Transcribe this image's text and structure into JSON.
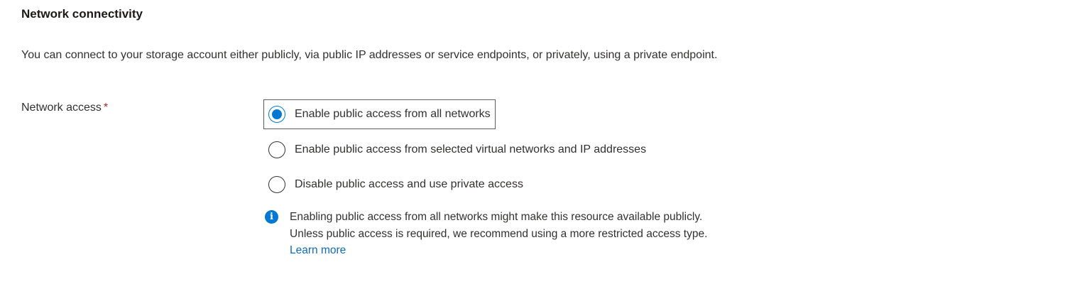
{
  "section": {
    "title": "Network connectivity",
    "description": "You can connect to your storage account either publicly, via public IP addresses or service endpoints, or privately, using a private endpoint."
  },
  "network_access": {
    "label": "Network access",
    "required_marker": "*",
    "selected_index": 0,
    "options": [
      {
        "label": "Enable public access from all networks",
        "checked": true
      },
      {
        "label": "Enable public access from selected virtual networks and IP addresses",
        "checked": false
      },
      {
        "label": "Disable public access and use private access",
        "checked": false
      }
    ]
  },
  "info": {
    "icon": "info-icon",
    "text": "Enabling public access from all networks might make this resource available publicly. Unless public access is required, we recommend using a more restricted access type.",
    "link_text": "Learn more"
  },
  "colors": {
    "accent": "#0078d4",
    "link": "#0f6cbd",
    "required": "#a4262c",
    "text": "#323130"
  }
}
